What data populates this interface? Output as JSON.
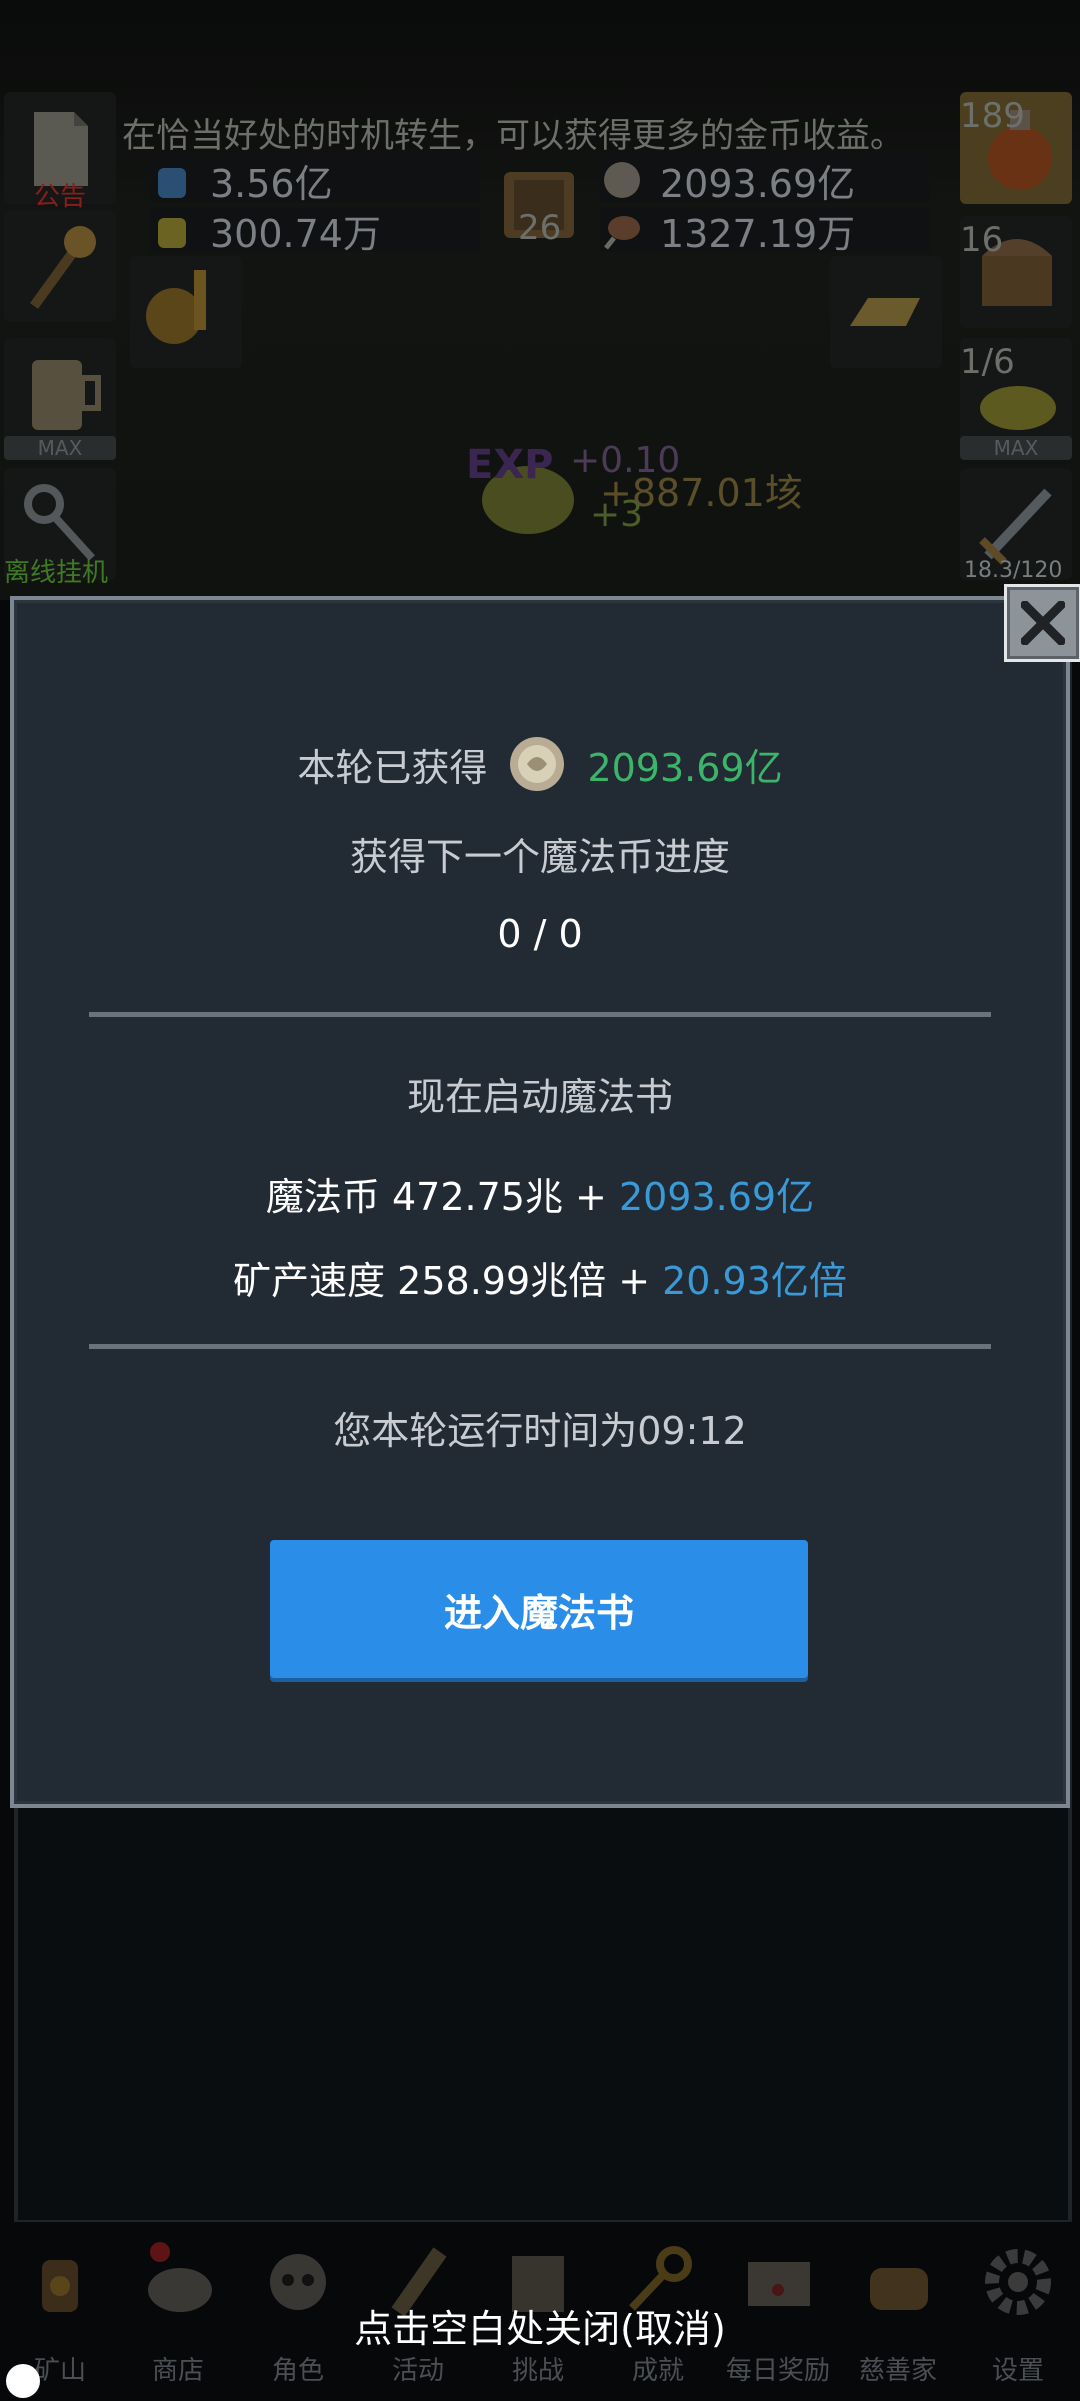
{
  "hud": {
    "tip": "在恰当好处的时机转生，可以获得更多的金币收益。",
    "notice_label": "公告",
    "res_blue_potion": "3.56亿",
    "res_yellow_potion": "300.74万",
    "book_level": "26",
    "res_coin": "2093.69亿",
    "res_meat": "1327.19万",
    "potion_count": "189",
    "chest_count": "16",
    "ore_progress": "1/6",
    "max_label": "MAX",
    "offline_label": "离线挂机",
    "sword_progress": "18.3/120",
    "float_exp": "+0.10",
    "float_gold": "+887.01垓",
    "float_plus": "+3"
  },
  "dialog": {
    "earned_label": "本轮已获得",
    "earned_value": "2093.69亿",
    "next_coin_label": "获得下一个魔法币进度",
    "progress": "0 / 0",
    "start_label": "现在启动魔法书",
    "magic_coin_label": "魔法币 472.75兆 + ",
    "magic_coin_gain": "2093.69亿",
    "speed_label": "矿产速度 258.99兆倍 + ",
    "speed_gain": "20.93亿倍",
    "runtime": "您本轮运行时间为09:12",
    "enter_button": "进入魔法书"
  },
  "close_hint": "点击空白处关闭(取消)",
  "nav": [
    {
      "label": "矿山",
      "icon": "lantern-icon"
    },
    {
      "label": "商店",
      "icon": "shop-pouch-icon"
    },
    {
      "label": "角色",
      "icon": "skull-icon"
    },
    {
      "label": "活动",
      "icon": "scroll-icon"
    },
    {
      "label": "挑战",
      "icon": "map-icon"
    },
    {
      "label": "成就",
      "icon": "key-icon"
    },
    {
      "label": "每日奖励",
      "icon": "envelope-icon"
    },
    {
      "label": "慈善家",
      "icon": "bread-icon"
    },
    {
      "label": "设置",
      "icon": "gear-icon"
    }
  ],
  "colors": {
    "gain_green": "#3cb56a",
    "gain_blue": "#3a9ad8",
    "button_blue": "#2a8de8",
    "dialog_bg": "#222a33"
  }
}
